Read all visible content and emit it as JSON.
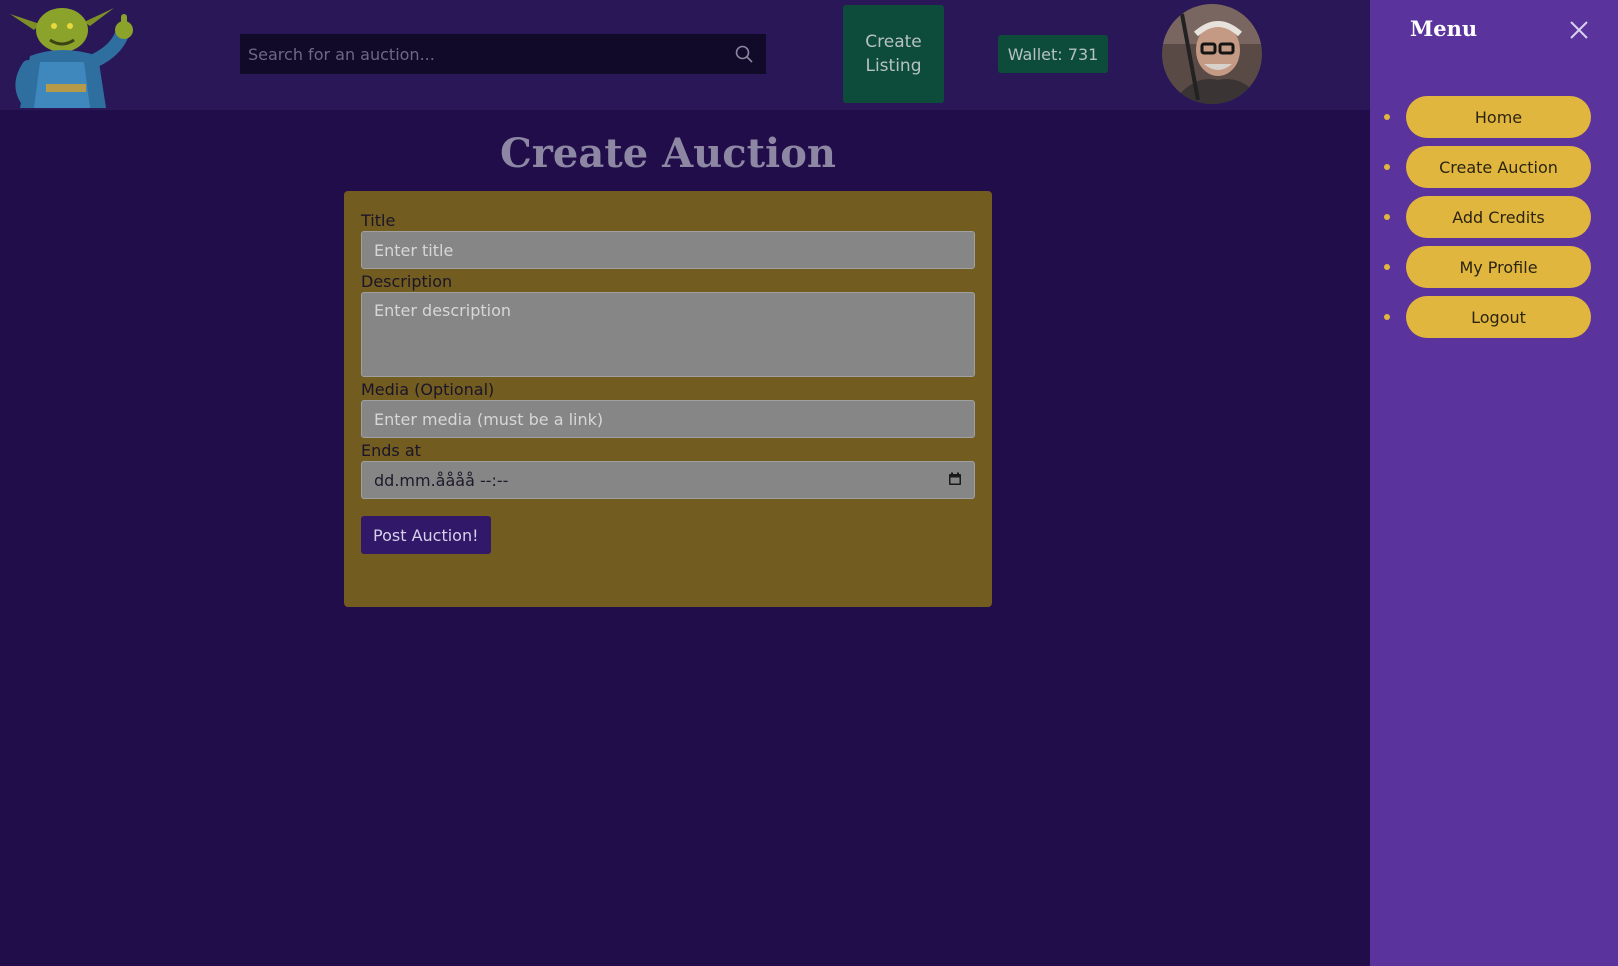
{
  "header": {
    "search_placeholder": "Search for an auction...",
    "create_listing_label": "Create Listing",
    "wallet_label": "Wallet: 731"
  },
  "main": {
    "page_title": "Create Auction",
    "form": {
      "title_label": "Title",
      "title_placeholder": "Enter title",
      "description_label": "Description",
      "description_placeholder": "Enter description",
      "media_label": "Media (Optional)",
      "media_placeholder": "Enter media (must be a link)",
      "ends_at_label": "Ends at",
      "ends_at_value": "dd.mm.åååå --:--",
      "submit_label": "Post Auction!"
    }
  },
  "sidebar": {
    "title": "Menu",
    "items": [
      {
        "label": "Home"
      },
      {
        "label": "Create Auction"
      },
      {
        "label": "Add Credits"
      },
      {
        "label": "My Profile"
      },
      {
        "label": "Logout"
      }
    ]
  },
  "icons": {
    "logo": "goblin-logo-icon",
    "search": "search-icon",
    "avatar": "user-avatar",
    "calendar": "calendar-icon",
    "close": "close-icon"
  },
  "colors": {
    "background": "#200d4a",
    "header": "#2a1758",
    "form_card": "#725c1f",
    "accent_green": "#0d4b3a",
    "menu_button": "#e0b63e",
    "sidebar": "#5a339c",
    "submit_button": "#311868"
  }
}
